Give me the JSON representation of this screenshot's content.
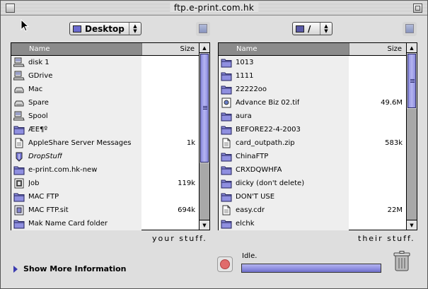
{
  "window": {
    "title": "ftp.e-print.com.hk"
  },
  "left_panel": {
    "location": "Desktop",
    "header": {
      "name": "Name",
      "size": "Size"
    },
    "items": [
      {
        "name": "disk 1",
        "size": "",
        "icon": "server-icon"
      },
      {
        "name": "GDrive",
        "size": "",
        "icon": "server-icon"
      },
      {
        "name": "Mac",
        "size": "",
        "icon": "disk-icon"
      },
      {
        "name": "Spare",
        "size": "",
        "icon": "disk-icon"
      },
      {
        "name": "Spool",
        "size": "",
        "icon": "server-icon"
      },
      {
        "name": "ÆЁ¶º",
        "size": "",
        "icon": "folder-icon"
      },
      {
        "name": "AppleShare Server Messages",
        "size": "1k",
        "icon": "document-icon"
      },
      {
        "name": "DropStuff",
        "size": "",
        "icon": "app-icon",
        "italic": true
      },
      {
        "name": "e-print.com.hk-new",
        "size": "",
        "icon": "folder-icon"
      },
      {
        "name": "Job",
        "size": "119k",
        "icon": "job-icon"
      },
      {
        "name": "MAC FTP",
        "size": "",
        "icon": "folder-icon"
      },
      {
        "name": "MAC FTP.sit",
        "size": "694k",
        "icon": "archive-icon"
      },
      {
        "name": "Mak Name Card folder",
        "size": "",
        "icon": "folder-icon"
      }
    ],
    "scroll_position": 0.0,
    "caption": "your stuff."
  },
  "right_panel": {
    "location": "/",
    "header": {
      "name": "Name",
      "size": "Size"
    },
    "items": [
      {
        "name": "1013",
        "size": "",
        "icon": "folder-icon"
      },
      {
        "name": "1111",
        "size": "",
        "icon": "folder-icon"
      },
      {
        "name": "22222oo",
        "size": "",
        "icon": "folder-icon"
      },
      {
        "name": "Advance Biz 02.tif",
        "size": "49.6M",
        "icon": "image-icon"
      },
      {
        "name": "aura",
        "size": "",
        "icon": "folder-icon"
      },
      {
        "name": "BEFORE22-4-2003",
        "size": "",
        "icon": "folder-icon"
      },
      {
        "name": "card_outpath.zip",
        "size": "583k",
        "icon": "document-icon"
      },
      {
        "name": "ChinaFTP",
        "size": "",
        "icon": "folder-icon"
      },
      {
        "name": "CRXDQWHFA",
        "size": "",
        "icon": "folder-icon"
      },
      {
        "name": "dicky (don't delete)",
        "size": "",
        "icon": "folder-icon"
      },
      {
        "name": "DON'T USE",
        "size": "",
        "icon": "folder-icon"
      },
      {
        "name": "easy.cdr",
        "size": "22M",
        "icon": "document-icon"
      },
      {
        "name": "elchk",
        "size": "",
        "icon": "folder-icon"
      }
    ],
    "scroll_position": 0.0,
    "caption": "their stuff."
  },
  "footer": {
    "more_info_label": "Show More Information",
    "status_text": "Idle.",
    "progress": 1.0
  }
}
